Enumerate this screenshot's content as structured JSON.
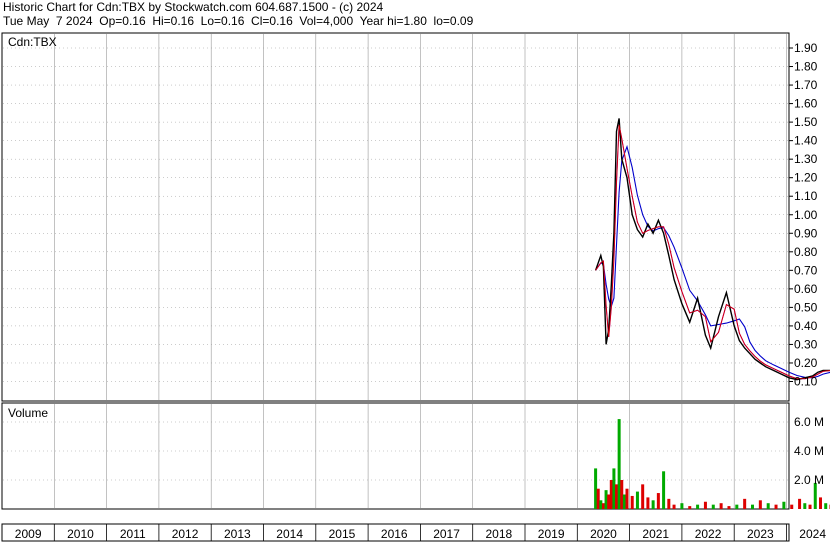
{
  "header": {
    "line1": "Historic Chart for Cdn:TBX by Stockwatch.com 604.687.1500 - (c) 2024",
    "line2": "Tue May  7 2024  Op=0.16  Hi=0.16  Lo=0.16  Cl=0.16  Vol=4,000  Year hi=1.80  lo=0.09"
  },
  "colors": {
    "price": "#000000",
    "ma_short": "#cc0000",
    "ma_fast": "#cc00cc",
    "ma_long": "#0000cc",
    "vol_up": "#00aa00",
    "vol_down": "#dd0000",
    "grid": "#999999"
  },
  "chart_data": [
    {
      "type": "line",
      "title": "Cdn:TBX",
      "ylim": [
        0.05,
        1.95
      ],
      "y_ticks": [
        "1.90",
        "1.80",
        "1.70",
        "1.60",
        "1.50",
        "1.40",
        "1.30",
        "1.20",
        "1.10",
        "1.00",
        "0.90",
        "0.80",
        "0.70",
        "0.60",
        "0.50",
        "0.40",
        "0.30",
        "0.20",
        "0.10"
      ],
      "x_labels": [
        "2009",
        "2010",
        "2011",
        "2012",
        "2013",
        "2014",
        "2015",
        "2016",
        "2017",
        "2018",
        "2019",
        "2020",
        "2021",
        "2022",
        "2023",
        "2024"
      ],
      "x": [
        2019.85,
        2019.95,
        2020.0,
        2020.05,
        2020.1,
        2020.15,
        2020.2,
        2020.25,
        2020.3,
        2020.35,
        2020.45,
        2020.55,
        2020.65,
        2020.75,
        2020.85,
        2020.95,
        2021.05,
        2021.15,
        2021.25,
        2021.35,
        2021.5,
        2021.65,
        2021.8,
        2021.95,
        2022.05,
        2022.2,
        2022.35,
        2022.5,
        2022.6,
        2022.7,
        2022.8,
        2022.9,
        2023.0,
        2023.1,
        2023.25,
        2023.4,
        2023.55,
        2023.7,
        2023.85,
        2024.0,
        2024.1,
        2024.2,
        2024.35
      ],
      "series": [
        {
          "name": "",
          "values": [
            0.7,
            0.78,
            0.72,
            0.3,
            0.38,
            0.62,
            0.9,
            1.45,
            1.52,
            1.3,
            1.2,
            1.0,
            0.92,
            0.88,
            0.95,
            0.9,
            0.97,
            0.9,
            0.78,
            0.65,
            0.52,
            0.42,
            0.55,
            0.35,
            0.28,
            0.45,
            0.58,
            0.4,
            0.32,
            0.28,
            0.25,
            0.22,
            0.2,
            0.18,
            0.16,
            0.14,
            0.12,
            0.11,
            0.12,
            0.13,
            0.15,
            0.16,
            0.16
          ]
        }
      ]
    },
    {
      "type": "bar",
      "title": "Volume",
      "ylim": [
        0,
        7.6
      ],
      "y_ticks": [
        "6.0 M",
        "4.0 M",
        "2.0 M"
      ],
      "x": [
        2019.85,
        2019.9,
        2019.95,
        2020.0,
        2020.05,
        2020.1,
        2020.15,
        2020.2,
        2020.25,
        2020.3,
        2020.35,
        2020.4,
        2020.45,
        2020.55,
        2020.65,
        2020.75,
        2020.85,
        2020.95,
        2021.05,
        2021.15,
        2021.25,
        2021.35,
        2021.5,
        2021.65,
        2021.8,
        2021.95,
        2022.1,
        2022.25,
        2022.4,
        2022.55,
        2022.7,
        2022.85,
        2023.0,
        2023.15,
        2023.3,
        2023.45,
        2023.6,
        2023.75,
        2023.85,
        2023.95,
        2024.05,
        2024.15,
        2024.25,
        2024.35
      ],
      "values": [
        2.8,
        1.4,
        0.6,
        0.4,
        1.3,
        1.0,
        2.0,
        2.8,
        1.7,
        6.2,
        2.0,
        1.0,
        1.4,
        0.9,
        1.2,
        1.7,
        0.8,
        0.6,
        1.1,
        2.6,
        0.7,
        0.3,
        0.4,
        0.2,
        0.3,
        0.5,
        0.3,
        0.4,
        0.2,
        0.3,
        0.7,
        0.3,
        0.6,
        0.4,
        0.3,
        0.5,
        0.3,
        0.7,
        0.4,
        0.3,
        1.8,
        0.8,
        0.4,
        0.3
      ],
      "up": [
        true,
        false,
        true,
        false,
        true,
        false,
        false,
        true,
        false,
        true,
        false,
        true,
        false,
        false,
        true,
        false,
        false,
        true,
        false,
        true,
        false,
        false,
        true,
        false,
        true,
        false,
        true,
        false,
        false,
        true,
        false,
        true,
        false,
        true,
        false,
        true,
        false,
        false,
        true,
        false,
        true,
        false,
        true,
        false
      ]
    }
  ]
}
